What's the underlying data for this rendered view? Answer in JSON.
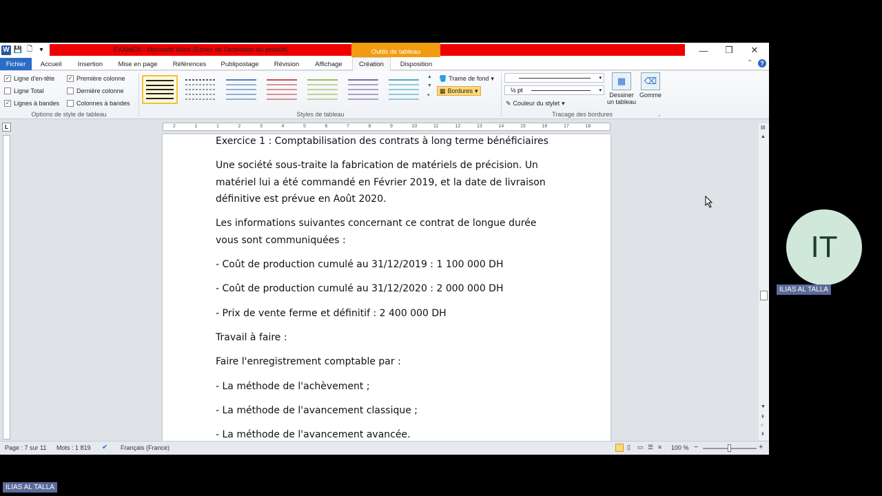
{
  "window": {
    "title": "EXAMEN  -  Microsoft Word (Échec de l'activation du produit)",
    "contextual_tab": "Outils de tableau",
    "controls": {
      "minimize": "—",
      "restore": "❐",
      "close": "✕"
    }
  },
  "tabs": [
    {
      "label": "Fichier"
    },
    {
      "label": "Accueil"
    },
    {
      "label": "Insertion"
    },
    {
      "label": "Mise en page"
    },
    {
      "label": "Références"
    },
    {
      "label": "Publipostage"
    },
    {
      "label": "Révision"
    },
    {
      "label": "Affichage"
    },
    {
      "label": "Création"
    },
    {
      "label": "Disposition"
    }
  ],
  "ribbon": {
    "style_options": {
      "label": "Options de style de tableau",
      "items": [
        {
          "label": "Ligne d'en-tête",
          "checked": true
        },
        {
          "label": "Ligne Total",
          "checked": false
        },
        {
          "label": "Lignes à bandes",
          "checked": true
        },
        {
          "label": "Première colonne",
          "checked": true
        },
        {
          "label": "Dernière colonne",
          "checked": false
        },
        {
          "label": "Colonnes à bandes",
          "checked": false
        }
      ]
    },
    "table_styles": {
      "label": "Styles de tableau",
      "colors": [
        "#222222",
        "#555555",
        "#4f81bd",
        "#c0504d",
        "#9bbb59",
        "#8064a2",
        "#4bacc6"
      ]
    },
    "shading_label": "Trame de fond",
    "borders_label": "Bordures",
    "line_weight": "½ pt",
    "pen_color_label": "Couleur du stylet",
    "draw_borders_label": "Tracage des bordures",
    "draw_table_label": "Dessiner un tableau",
    "eraser_label": "Gomme"
  },
  "ruler": {
    "marks": [
      "2",
      "1",
      "1",
      "2",
      "3",
      "4",
      "5",
      "6",
      "7",
      "8",
      "9",
      "10",
      "11",
      "12",
      "13",
      "14",
      "15",
      "16",
      "17",
      "18"
    ]
  },
  "document": {
    "lines": [
      "Exercice 1 : Comptabilisation des contrats à long terme bénéficiaires",
      "Une société sous-traite  la fabrication de matériels de précision. Un",
      "matériel lui a été commandé en Février 2019, et la date de livraison",
      "définitive est prévue en Août 2020.",
      " Les informations suivantes concernant  ce contrat de longue durée",
      "vous sont communiquées  :",
      " - Coût de production cumulé au 31/12/2019 : 1 100 000 DH",
      "- Coût de production cumulé au 31/12/2020 : 2 000 000 DH",
      " - Prix de vente ferme et définitif  : 2 400 000 DH",
      "Travail à faire :",
      "Faire l'enregistrement  comptable par :",
      "- La méthode de l'achèvement  ;",
      "- La méthode de l'avancement classique  ;",
      "- La méthode de l'avancement avancée."
    ]
  },
  "status": {
    "page": "Page : 7 sur 11",
    "words": "Mots : 1 819",
    "language": "Français (France)",
    "zoom": "100 %",
    "zoom_minus": "−",
    "zoom_plus": "+"
  },
  "overlay": {
    "avatar_initials": "IT",
    "participant_name": "ILIAS AL TALLA",
    "presenter_name": "ILIAS AL TALLA"
  }
}
